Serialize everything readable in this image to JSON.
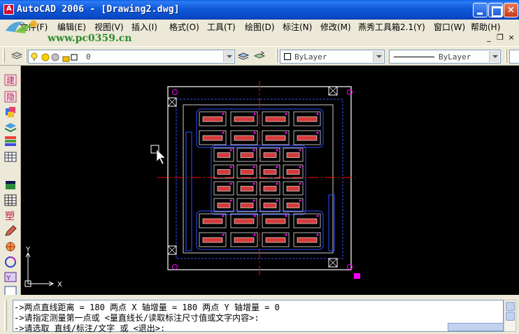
{
  "window": {
    "title": "AutoCAD 2006 - [Drawing2.dwg]",
    "controls": {
      "minimize": "",
      "maximize": "",
      "close": "×"
    }
  },
  "watermark": {
    "url": "www.pc0359.cn"
  },
  "menu": {
    "items": [
      {
        "label": "文件(F)"
      },
      {
        "label": "编辑(E)"
      },
      {
        "label": "视图(V)"
      },
      {
        "label": "插入(I)"
      },
      {
        "label": "格式(O)"
      },
      {
        "label": "工具(T)"
      },
      {
        "label": "绘图(D)"
      },
      {
        "label": "标注(N)"
      },
      {
        "label": "修改(M)"
      },
      {
        "label": "燕秀工具箱2.1(Y)"
      },
      {
        "label": "窗口(W)"
      },
      {
        "label": "帮助(H)"
      }
    ],
    "doc_controls": {
      "minimize": "_",
      "restore": "❐",
      "close": "×"
    }
  },
  "toolbar": {
    "layer_value": "0",
    "color_value": "ByLayer",
    "linetype_value": "ByLayer"
  },
  "ucs": {
    "y_label": "Y",
    "x_label": "X"
  },
  "command": {
    "lines": [
      "->两点直线距离 = 180  两点 X 轴增量 = 180  两点 Y 轴增量 = 0",
      "->请指定测量第一点或 <量直线长/读取标注尺寸值或文字内容>:",
      "->请选取 直线/标注/文字 或 <退出>:"
    ]
  },
  "colors": {
    "canvas_bg": "#000000",
    "mold_outline": "#ffffff",
    "centerline": "#ff0000",
    "cavity": "#d23b3b",
    "guide": "#3050ff",
    "accent": "#ff00ff"
  }
}
